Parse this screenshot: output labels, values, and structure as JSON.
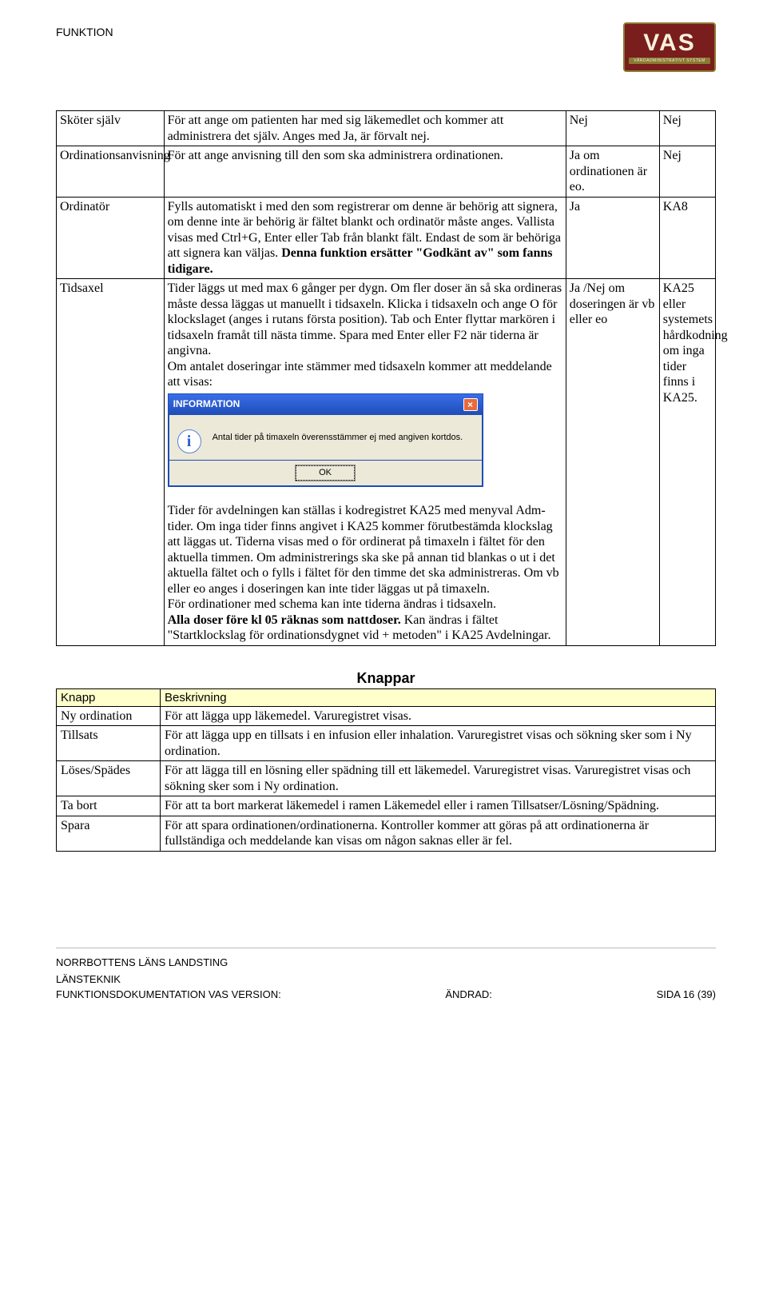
{
  "header": {
    "left": "FUNKTION",
    "logo_text": "VAS",
    "logo_sub": "VÅRDADMINISTRATIVT SYSTEM"
  },
  "table1": {
    "rows": [
      {
        "c1": "Sköter själv",
        "c2": "För att ange om patienten har med sig läkemedlet och kommer att administrera det själv. Anges med Ja, är förvalt nej.",
        "c3": "Nej",
        "c4": "Nej"
      },
      {
        "c1": "Ordinationsanvisning",
        "c2": "För att ange anvisning till den som ska administrera ordinationen.",
        "c3": "Ja om ordinationen är eo.",
        "c4": "Nej"
      },
      {
        "c1": "Ordinatör",
        "c2_pre": "Fylls automatiskt i med den som registrerar om denne är behörig att signera, om denne inte är behörig är fältet blankt och ordinatör måste anges. Vallista visas med Ctrl+G, Enter eller Tab från blankt fält. Endast de som är behöriga att signera kan väljas. ",
        "c2_bold": "Denna funktion ersätter \"Godkänt av\" som fanns tidigare.",
        "c3": "Ja",
        "c4": "KA8"
      },
      {
        "c1": "Tidsaxel",
        "c2_p1": "Tider läggs ut med max 6 gånger per dygn. Om fler doser än så ska ordineras måste dessa läggas ut manuellt i tidsaxeln. Klicka i tidsaxeln och ange O för klockslaget (anges i rutans första position). Tab och Enter flyttar markören i tidsaxeln framåt till nästa timme. Spara med Enter eller F2 när tiderna är angivna.",
        "c2_p2": "Om antalet doseringar inte stämmer med tidsaxeln kommer att meddelande att visas:",
        "c3": "Ja /Nej om doseringen är vb eller eo",
        "c4": "KA25 eller systemets hårdkodning om inga tider finns i KA25."
      }
    ],
    "tidsaxel_extra": {
      "p1": "Tider för avdelningen kan ställas i kodregistret KA25 med menyval Adm-tider. Om inga tider finns angivet i KA25 kommer förutbestämda klockslag att läggas ut. Tiderna visas med o för ordinerat på timaxeln i fältet för den aktuella timmen. Om administrerings ska ske på annan tid blankas o ut i det aktuella fältet och o fylls i fältet för den timme det ska administreras. Om vb eller eo anges i doseringen kan inte tider läggas ut på timaxeln.",
      "p2": "För ordinationer med schema kan inte tiderna ändras i tidsaxeln.",
      "p3_bold": "Alla doser före kl 05 räknas som nattdoser.",
      "p3_rest": " Kan ändras i fältet \"Startklockslag för ordinationsdygnet vid + metoden\" i KA25 Avdelningar."
    }
  },
  "dialog": {
    "title": "INFORMATION",
    "msg": "Antal tider på timaxeln överensstämmer ej med angiven kortdos.",
    "ok": "OK"
  },
  "section_knappar": {
    "heading": "Knappar",
    "th1": "Knapp",
    "th2": "Beskrivning",
    "rows": [
      {
        "c1": "Ny ordination",
        "c2": "För att lägga upp läkemedel. Varuregistret visas."
      },
      {
        "c1": "Tillsats",
        "c2": "För att lägga upp en tillsats i en infusion eller inhalation. Varuregistret visas och sökning sker som i Ny ordination."
      },
      {
        "c1": "Löses/Spädes",
        "c2": "För att lägga till en lösning eller spädning till ett läkemedel. Varuregistret visas. Varuregistret visas och sökning sker som i Ny ordination."
      },
      {
        "c1": "Ta bort",
        "c2": "För att ta bort markerat läkemedel i ramen Läkemedel eller i ramen Tillsatser/Lösning/Spädning."
      },
      {
        "c1": "Spara",
        "c2": "För att spara ordinationen/ordinationerna. Kontroller kommer att göras på att ordinationerna är fullständiga och meddelande kan visas om någon saknas eller är fel."
      }
    ]
  },
  "footer": {
    "l1": "NORRBOTTENS LÄNS LANDSTING",
    "l2": "LÄNSTEKNIK",
    "l3_left": "FUNKTIONSDOKUMENTATION VAS VERSION:",
    "l3_mid": "ÄNDRAD:",
    "l3_right": "SIDA 16 (39)"
  }
}
